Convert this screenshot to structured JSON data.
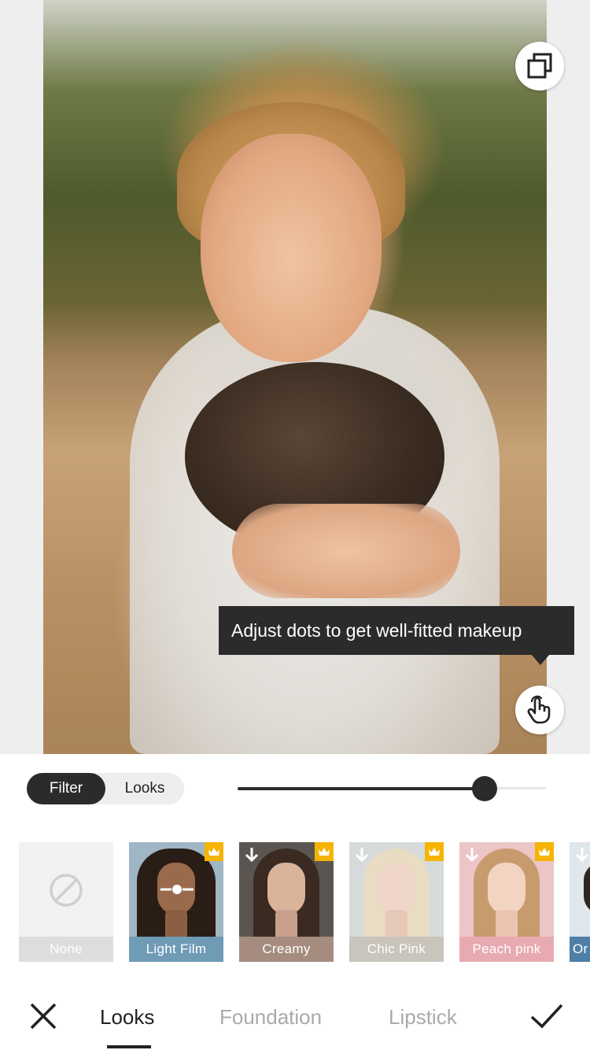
{
  "tooltip": {
    "text": "Adjust dots to get well-fitted makeup"
  },
  "mode_toggle": {
    "options": [
      "Filter",
      "Looks"
    ],
    "selected": "Filter"
  },
  "intensity_slider": {
    "value_fraction": 0.8
  },
  "presets": [
    {
      "label": "None",
      "premium": false,
      "downloadable": false,
      "selected": false,
      "label_bg": "#dddddd",
      "icon": "none-icon"
    },
    {
      "label": "Light Film",
      "premium": true,
      "downloadable": false,
      "selected": true,
      "label_bg": "#6f9bb5",
      "icon": "adjust-icon"
    },
    {
      "label": "Creamy",
      "premium": true,
      "downloadable": true,
      "selected": false,
      "label_bg": "#a58c7f",
      "icon": "download-icon"
    },
    {
      "label": "Chic Pink",
      "premium": true,
      "downloadable": true,
      "selected": false,
      "label_bg": "#c9c4bc",
      "icon": "download-icon"
    },
    {
      "label": "Peach pink",
      "premium": true,
      "downloadable": true,
      "selected": false,
      "label_bg": "#e7aab0",
      "icon": "download-icon"
    },
    {
      "label": "Or",
      "premium": false,
      "downloadable": true,
      "selected": false,
      "label_bg": "#4f7ea9",
      "icon": "download-icon"
    }
  ],
  "bottom_nav": {
    "tabs": [
      "Looks",
      "Foundation",
      "Lipstick"
    ],
    "active_tab": "Looks"
  },
  "colors": {
    "accent_dark": "#2b2b2b",
    "crown": "#f5b400",
    "inactive_tab": "#aaaaaa"
  }
}
